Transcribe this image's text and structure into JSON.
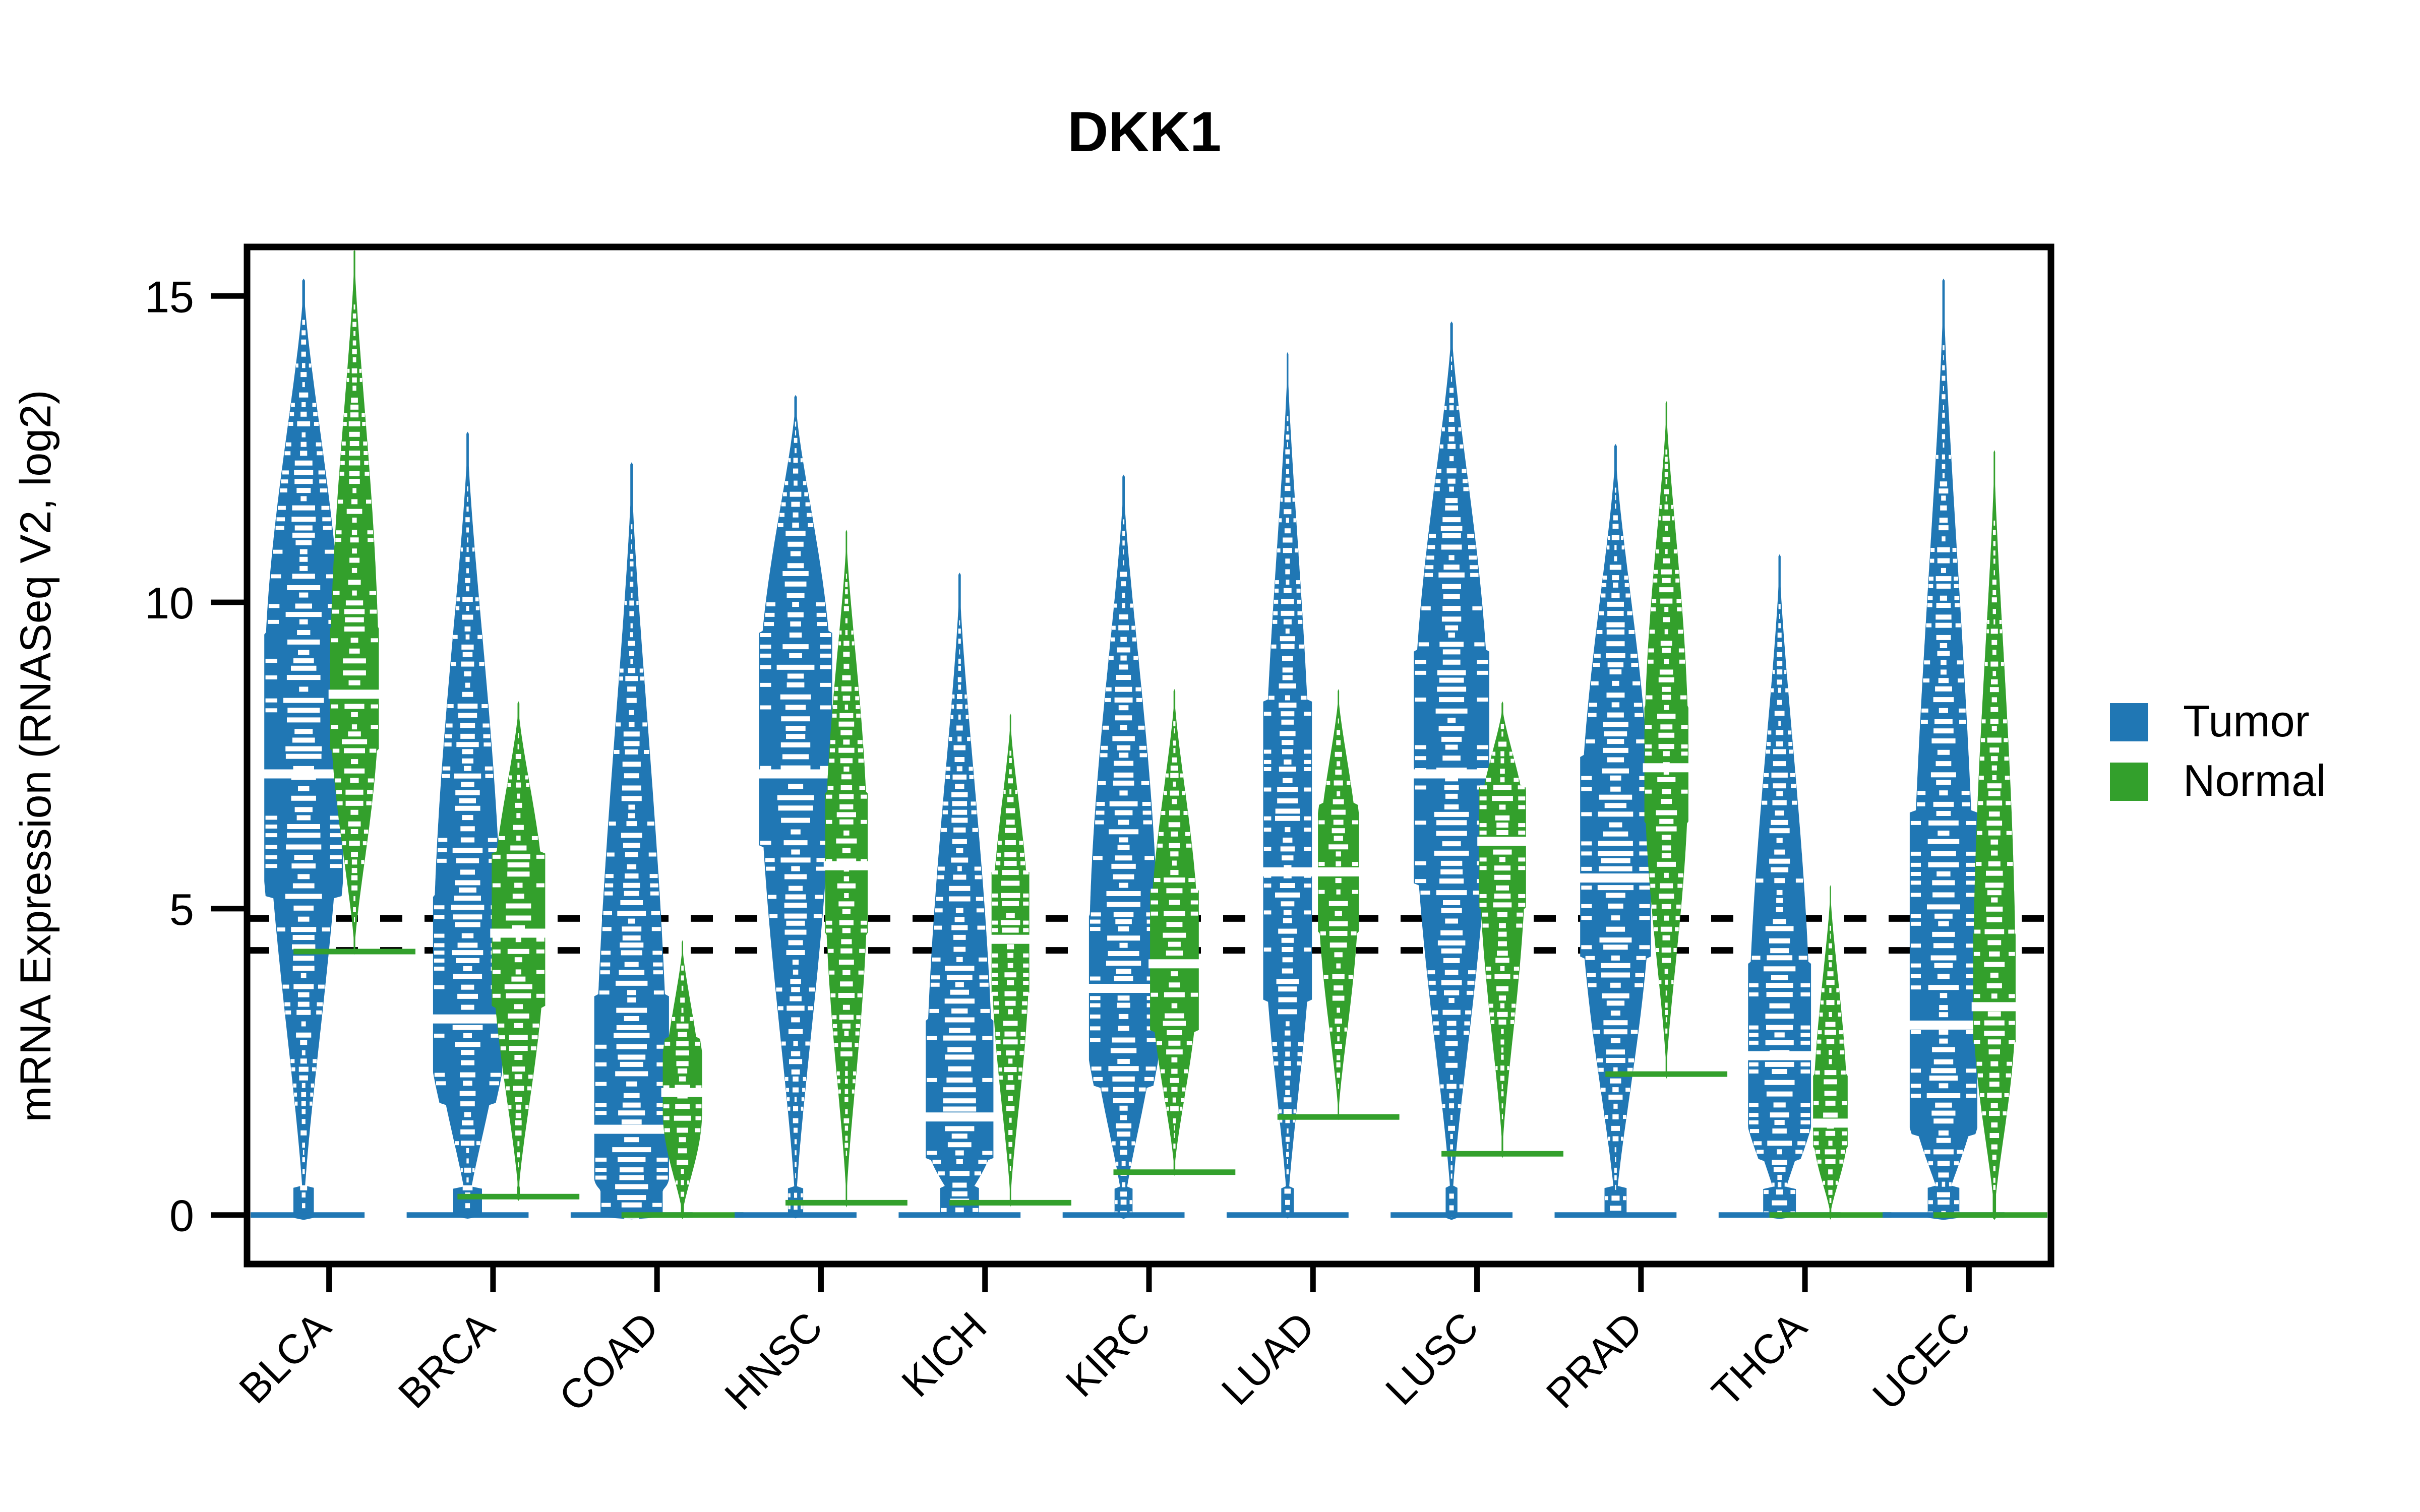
{
  "chart_data": {
    "type": "violin",
    "title": "DKK1",
    "xlabel": "",
    "ylabel": "mRNA Expression (RNASeq V2, log2)",
    "ylim": [
      -0.8,
      15.8
    ],
    "yticks": [
      0,
      5,
      10,
      15
    ],
    "ytick_labels": [
      "0",
      "5",
      "10",
      "15"
    ],
    "grid": false,
    "legend_position": "right",
    "legend": [
      {
        "name": "Tumor",
        "color": "#2077b4"
      },
      {
        "name": "Normal",
        "color": "#33a02c"
      }
    ],
    "reference_lines": [
      {
        "value": 4.84,
        "style": "dotted",
        "color": "#000000"
      },
      {
        "value": 4.32,
        "style": "dotted",
        "color": "#000000"
      }
    ],
    "categories": [
      "BLCA",
      "BRCA",
      "COAD",
      "HNSC",
      "KICH",
      "KIRC",
      "LUAD",
      "LUSC",
      "PRAD",
      "THCA",
      "UCEC"
    ],
    "series": [
      {
        "name": "Tumor",
        "color": "#2077b4",
        "groups": [
          {
            "category": "BLCA",
            "min": 0.0,
            "max": 15.2,
            "q1": 5.2,
            "median": 7.2,
            "q3": 9.5,
            "peak": 8.4,
            "width": 1.0,
            "zero_mass": 0.1
          },
          {
            "category": "BRCA",
            "min": 0.0,
            "max": 12.7,
            "q1": 1.8,
            "median": 3.2,
            "q3": 5.2,
            "peak": 3.6,
            "width": 0.88,
            "zero_mass": 0.16
          },
          {
            "category": "COAD",
            "min": 0.0,
            "max": 12.2,
            "q1": 0.7,
            "median": 1.4,
            "q3": 3.6,
            "peak": 0.6,
            "width": 0.95,
            "zero_mass": 0.32
          },
          {
            "category": "HNSC",
            "min": 0.0,
            "max": 13.3,
            "q1": 6.0,
            "median": 7.2,
            "q3": 9.5,
            "peak": 8.3,
            "width": 0.93,
            "zero_mass": 0.08
          },
          {
            "category": "KICH",
            "min": 0.0,
            "max": 10.4,
            "q1": 0.9,
            "median": 1.6,
            "q3": 3.2,
            "peak": 1.3,
            "width": 0.86,
            "zero_mass": 0.22
          },
          {
            "category": "KIRC",
            "min": 0.0,
            "max": 12.0,
            "q1": 2.1,
            "median": 3.7,
            "q3": 4.9,
            "peak": 3.9,
            "width": 0.88,
            "zero_mass": 0.1
          },
          {
            "category": "LUAD",
            "min": 0.0,
            "max": 14.0,
            "q1": 3.5,
            "median": 5.6,
            "q3": 8.4,
            "peak": 5.4,
            "width": 0.62,
            "zero_mass": 0.1
          },
          {
            "category": "LUSC",
            "min": 0.0,
            "max": 14.5,
            "q1": 5.4,
            "median": 7.2,
            "q3": 9.2,
            "peak": 7.6,
            "width": 0.96,
            "zero_mass": 0.06
          },
          {
            "category": "PRAD",
            "min": 0.0,
            "max": 12.5,
            "q1": 4.2,
            "median": 5.5,
            "q3": 7.5,
            "peak": 5.8,
            "width": 0.9,
            "zero_mass": 0.12
          },
          {
            "category": "THCA",
            "min": 0.0,
            "max": 10.7,
            "q1": 0.9,
            "median": 2.6,
            "q3": 4.1,
            "peak": 2.2,
            "width": 0.8,
            "zero_mass": 0.2
          },
          {
            "category": "UCEC",
            "min": 0.0,
            "max": 15.2,
            "q1": 1.3,
            "median": 3.1,
            "q3": 6.6,
            "peak": 2.2,
            "width": 0.86,
            "zero_mass": 0.18
          }
        ]
      },
      {
        "name": "Normal",
        "color": "#33a02c",
        "groups": [
          {
            "category": "BLCA",
            "min": 4.3,
            "max": 15.7,
            "q1": 7.6,
            "median": 8.5,
            "q3": 9.6,
            "peak": 8.5,
            "width": 0.62,
            "zero_mass": 0.0
          },
          {
            "category": "BRCA",
            "min": 0.3,
            "max": 8.3,
            "q1": 3.4,
            "median": 4.6,
            "q3": 5.9,
            "peak": 4.7,
            "width": 0.68,
            "zero_mass": 0.02
          },
          {
            "category": "COAD",
            "min": 0.0,
            "max": 4.4,
            "q1": 1.6,
            "median": 2.0,
            "q3": 2.9,
            "peak": 1.7,
            "width": 0.5,
            "zero_mass": 0.03
          },
          {
            "category": "HNSC",
            "min": 0.2,
            "max": 11.1,
            "q1": 4.6,
            "median": 5.7,
            "q3": 6.9,
            "peak": 5.7,
            "width": 0.54,
            "zero_mass": 0.0
          },
          {
            "category": "KICH",
            "min": 0.2,
            "max": 8.1,
            "q1": 3.6,
            "median": 4.5,
            "q3": 5.6,
            "peak": 4.4,
            "width": 0.48,
            "zero_mass": 0.0
          },
          {
            "category": "KIRC",
            "min": 0.7,
            "max": 8.5,
            "q1": 3.0,
            "median": 4.1,
            "q3": 5.3,
            "peak": 4.2,
            "width": 0.62,
            "zero_mass": 0.01
          },
          {
            "category": "LUAD",
            "min": 1.6,
            "max": 8.5,
            "q1": 4.6,
            "median": 5.6,
            "q3": 6.7,
            "peak": 5.5,
            "width": 0.52,
            "zero_mass": 0.0
          },
          {
            "category": "LUSC",
            "min": 1.0,
            "max": 8.3,
            "q1": 5.0,
            "median": 6.1,
            "q3": 7.0,
            "peak": 6.2,
            "width": 0.6,
            "zero_mass": 0.0
          },
          {
            "category": "PRAD",
            "min": 2.3,
            "max": 13.2,
            "q1": 6.4,
            "median": 7.3,
            "q3": 8.3,
            "peak": 7.4,
            "width": 0.56,
            "zero_mass": 0.0
          },
          {
            "category": "THCA",
            "min": 0.0,
            "max": 5.3,
            "q1": 1.1,
            "median": 1.5,
            "q3": 2.3,
            "peak": 1.4,
            "width": 0.44,
            "zero_mass": 0.02
          },
          {
            "category": "UCEC",
            "min": 0.0,
            "max": 12.4,
            "q1": 2.8,
            "median": 3.4,
            "q3": 4.6,
            "peak": 3.5,
            "width": 0.54,
            "zero_mass": 0.03
          }
        ]
      }
    ]
  }
}
